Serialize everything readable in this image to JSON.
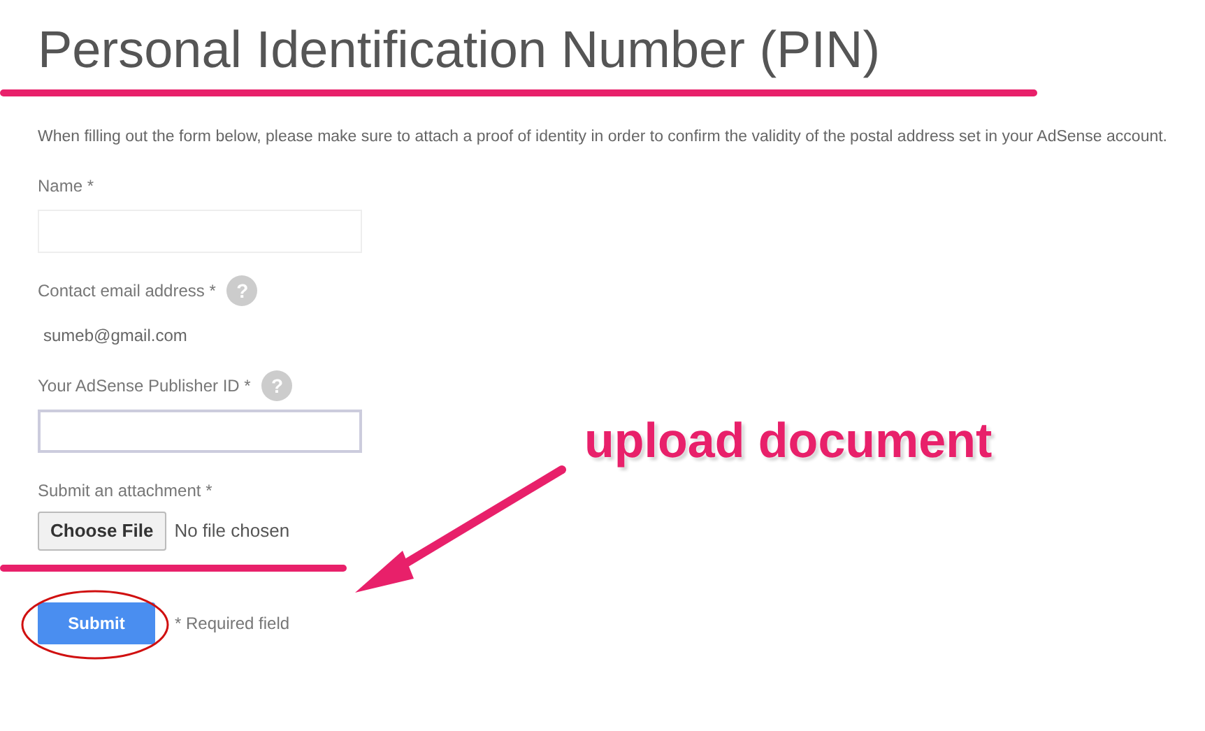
{
  "title": "Personal Identification Number (PIN)",
  "intro": "When filling out the form below, please make sure to attach a proof of identity in order to confirm the validity of the postal address set in your AdSense account.",
  "fields": [
    {
      "kind": "input",
      "label": "Name *"
    },
    {
      "kind": "static",
      "label": "Contact email address *",
      "help": "?",
      "value": "sumeb@gmail.com"
    },
    {
      "kind": "input",
      "label": "Your AdSense Publisher ID *",
      "help": "?"
    },
    {
      "kind": "file",
      "label": "Submit an attachment *",
      "button": "Choose File",
      "status": "No file chosen"
    }
  ],
  "submit": "Submit",
  "required_note": "* Required field",
  "annotation": "upload document"
}
